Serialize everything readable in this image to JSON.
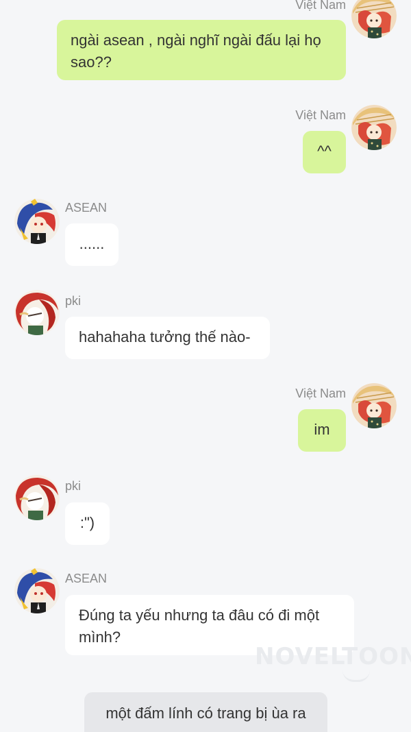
{
  "messages": [
    {
      "id": "m1",
      "sender": "Việt Nam",
      "side": "right",
      "text": "ngài asean , ngài nghĩ ngài đấu lại họ sao??"
    },
    {
      "id": "m2",
      "sender": "Việt Nam",
      "side": "right",
      "text": "^^"
    },
    {
      "id": "m3",
      "sender": "ASEAN",
      "side": "left",
      "text": "......"
    },
    {
      "id": "m4",
      "sender": "pki",
      "side": "left",
      "text": "hahahaha tưởng thế nào-"
    },
    {
      "id": "m5",
      "sender": "Việt Nam",
      "side": "right",
      "text": "im"
    },
    {
      "id": "m6",
      "sender": "pki",
      "side": "left",
      "text": ":\")"
    },
    {
      "id": "m7",
      "sender": "ASEAN",
      "side": "left",
      "text": "Đúng ta yếu nhưng ta đâu có đi một mình?"
    }
  ],
  "narration": "một đấm lính có trang bị ùa ra",
  "watermark": "NOVELTOON",
  "colors": {
    "background": "#f5f6f8",
    "my_bubble": "#d8f59b",
    "their_bubble": "#ffffff",
    "narration_bubble": "#e6e7ea",
    "sender_name": "#8b8b8b"
  },
  "icons": {
    "vietnam_avatar": "vietnam-character-avatar",
    "asean_avatar": "asean-character-avatar",
    "pki_avatar": "pki-character-avatar"
  }
}
